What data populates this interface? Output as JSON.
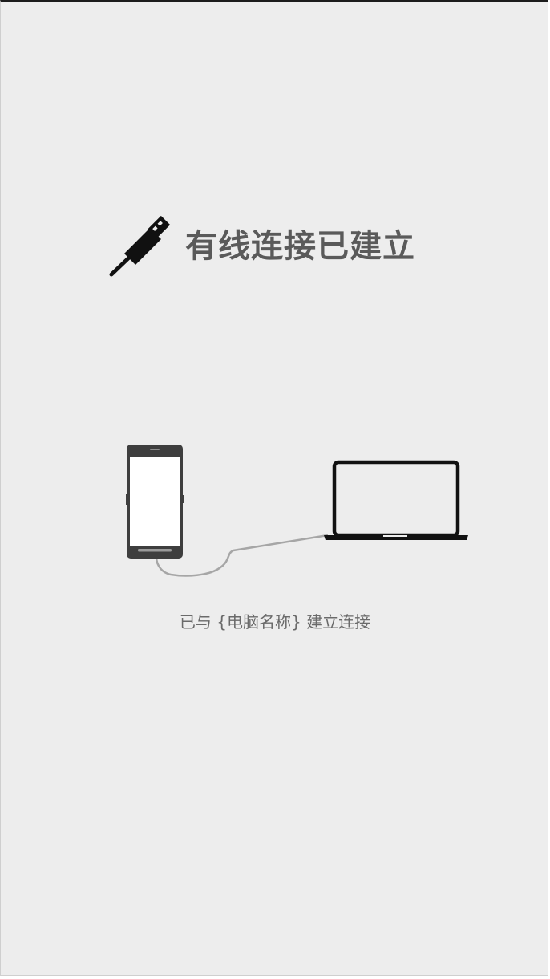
{
  "header": {
    "title": "有线连接已建立",
    "icon": "usb-plug-icon"
  },
  "illustration": {
    "phone_icon": "phone-icon",
    "laptop_icon": "laptop-icon",
    "cable_icon": "usb-cable-icon"
  },
  "status": {
    "message": "已与 {电脑名称} 建立连接"
  },
  "colors": {
    "background": "#ededed",
    "title_text": "#5a5a5a",
    "status_text": "#6a6a6a",
    "icon": "#111111",
    "phone_body": "#3e3e3e",
    "cable": "#a6a6a6"
  }
}
